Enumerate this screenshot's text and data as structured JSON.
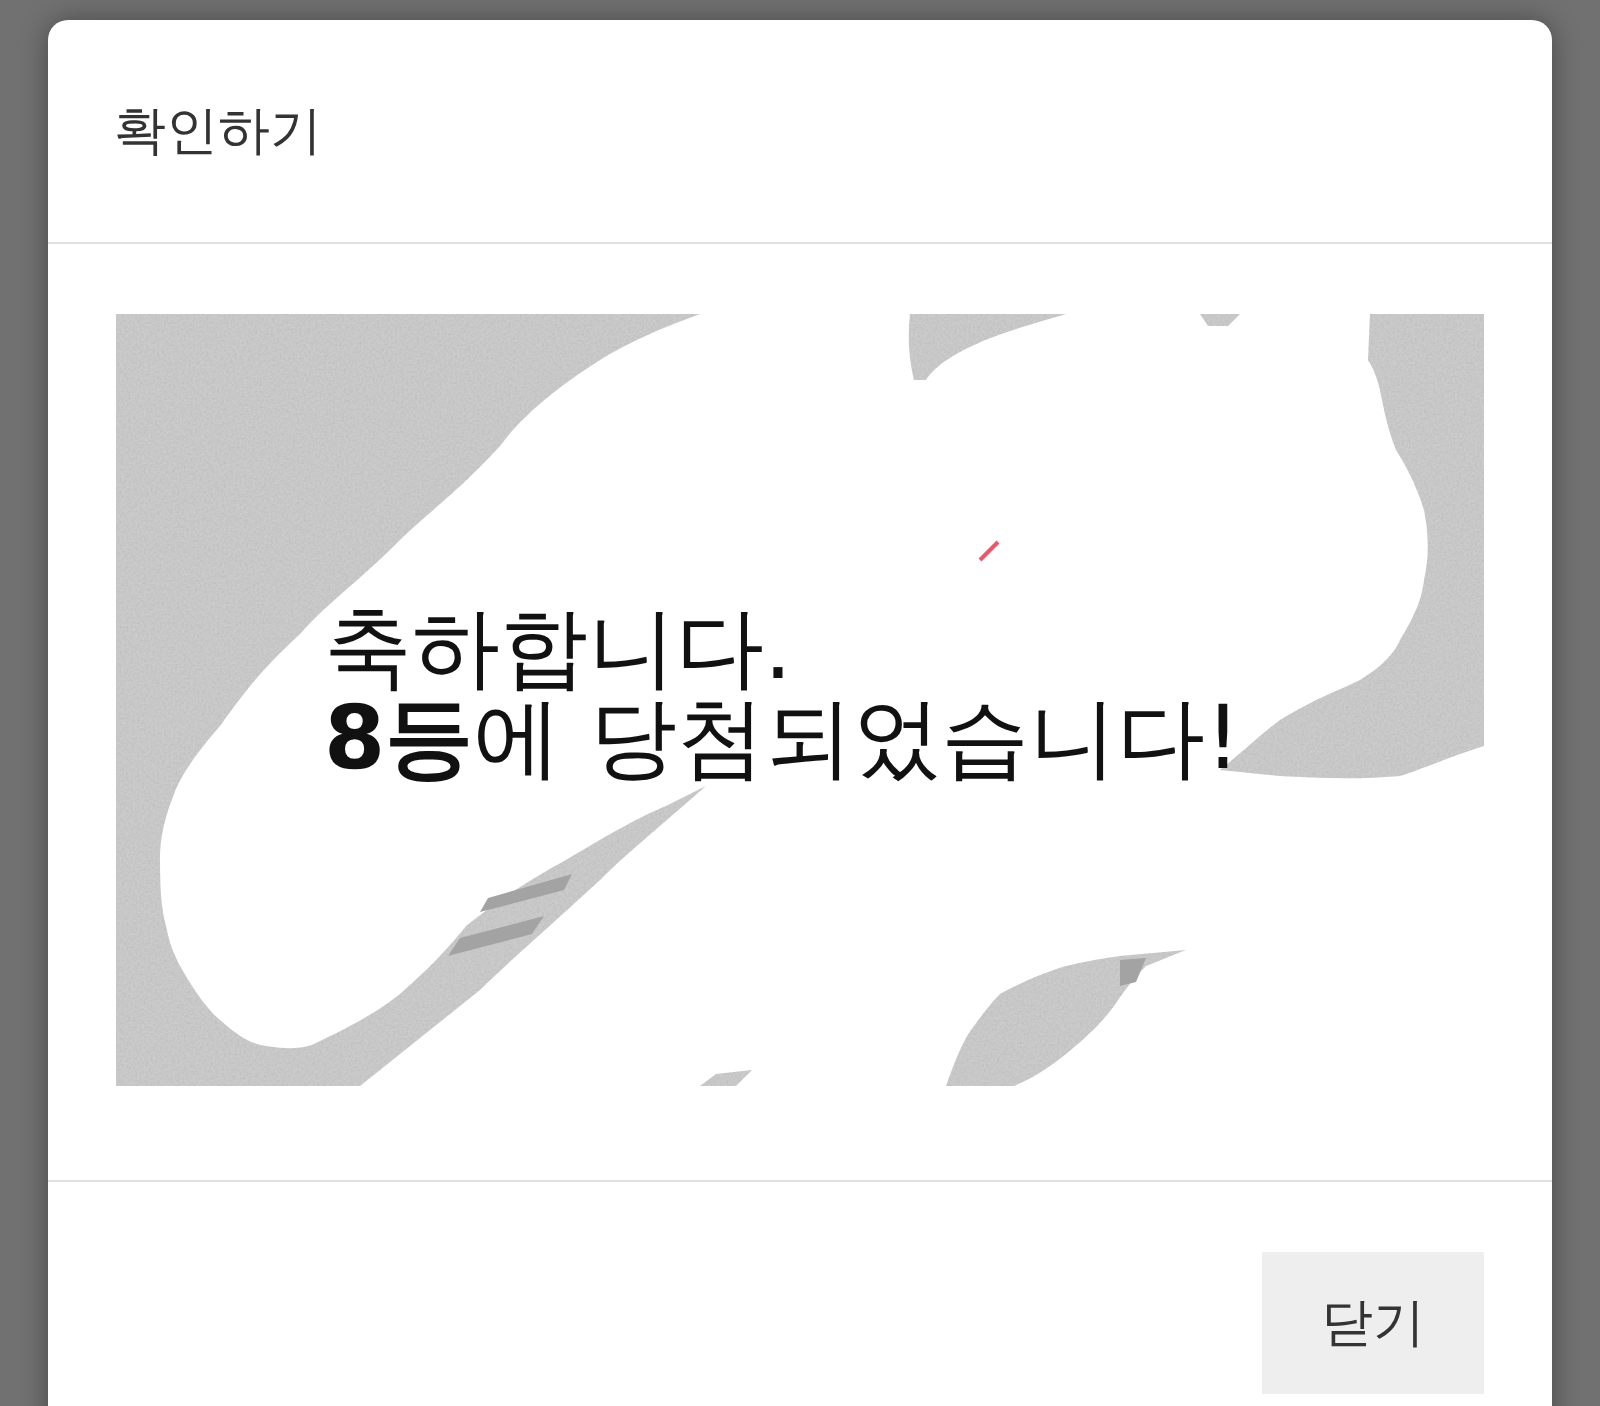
{
  "dialog": {
    "title": "확인하기",
    "scratch_card": {
      "lines": [
        "축하합니다.",
        "**8등**에 당첨되었습니다!"
      ]
    },
    "footer": {
      "buttons": [
        {
          "label": "닫기"
        }
      ]
    }
  }
}
